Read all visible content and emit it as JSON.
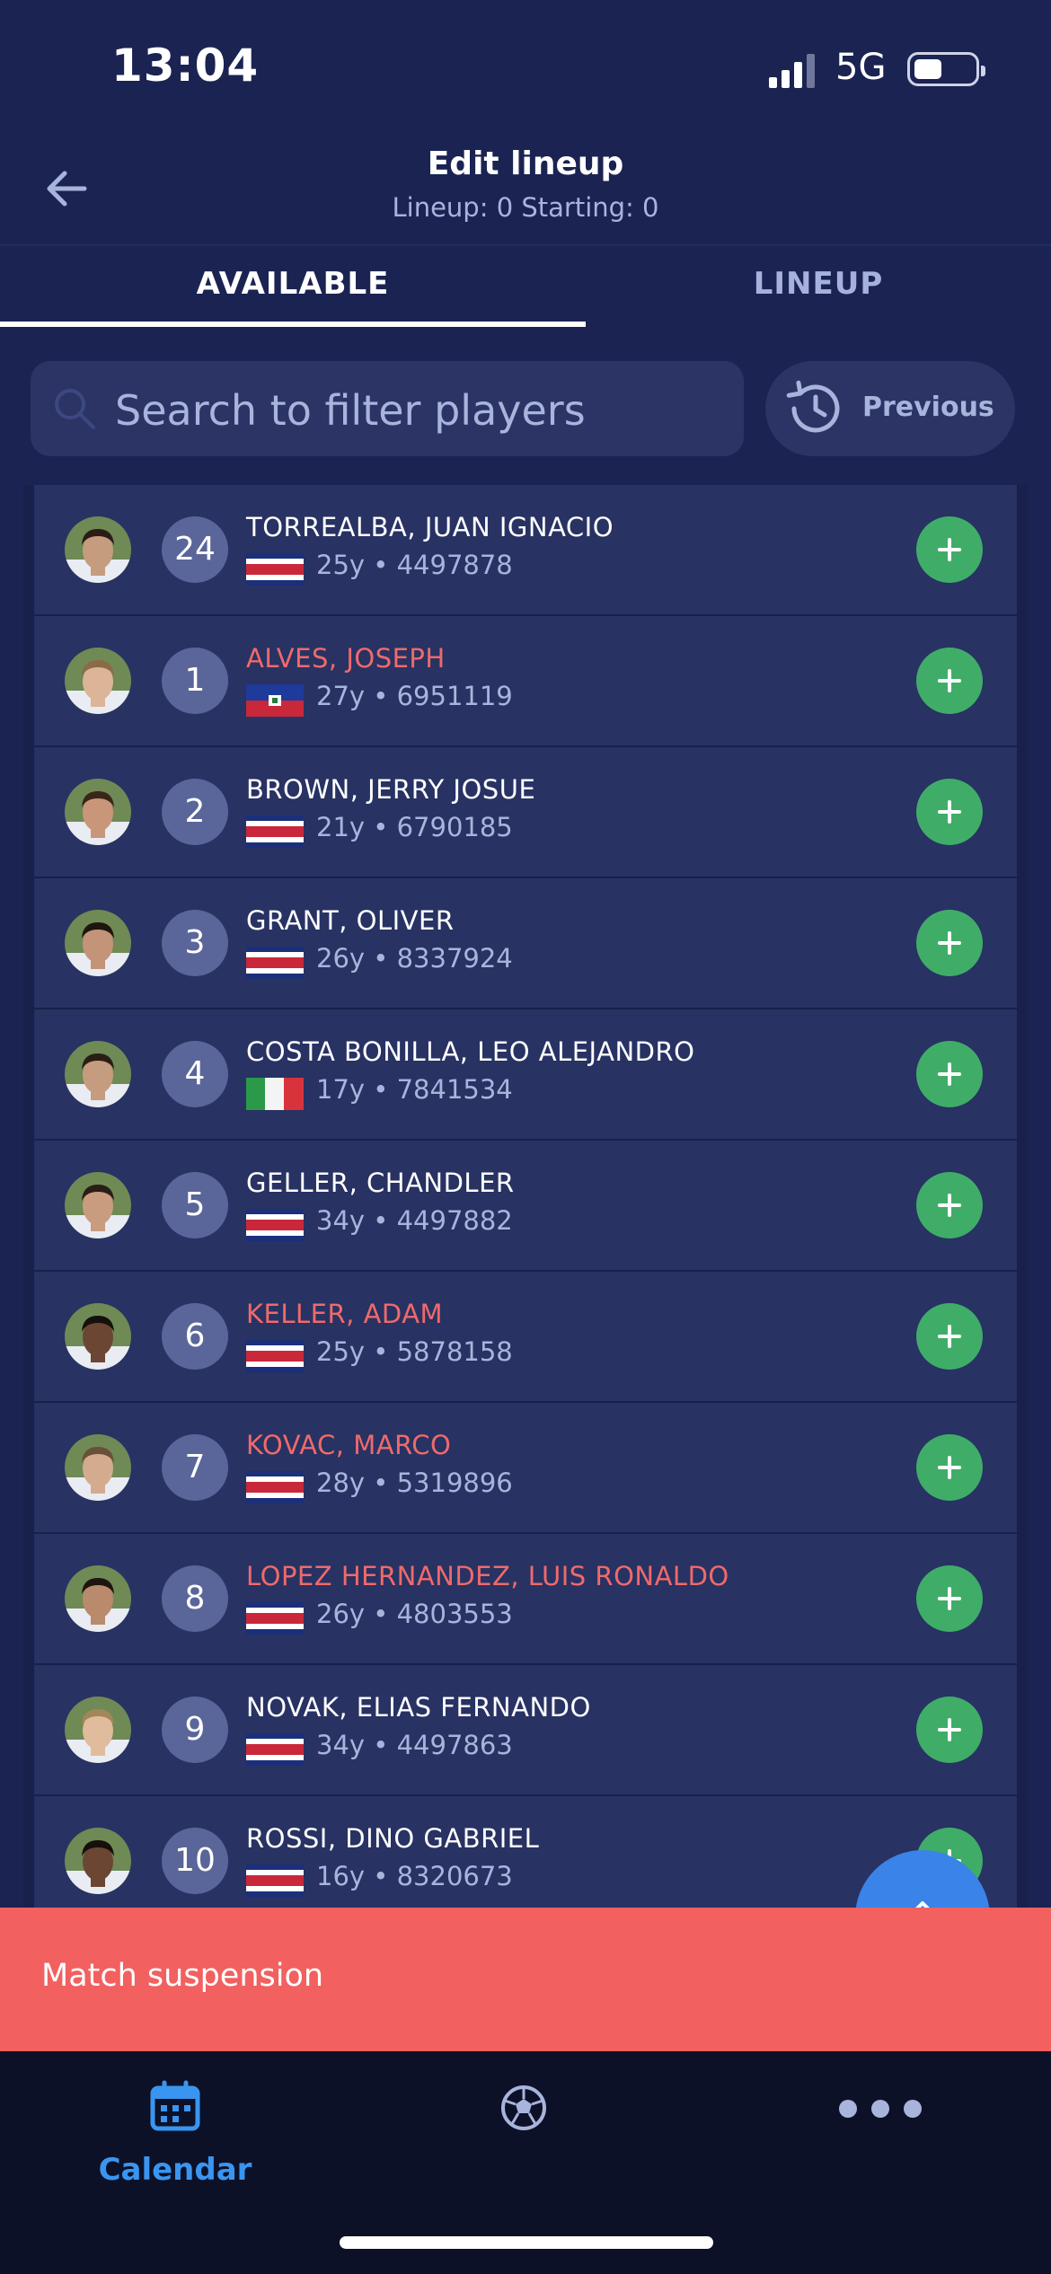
{
  "status_bar": {
    "time": "13:04",
    "network": "5G",
    "battery_level": 0.45
  },
  "header": {
    "title": "Edit lineup",
    "subtitle": "Lineup: 0 Starting: 0",
    "back_icon": "arrow-left-icon"
  },
  "tabs": {
    "available": "AVAILABLE",
    "lineup": "LINEUP",
    "active": "AVAILABLE"
  },
  "search": {
    "placeholder": "Search to filter players",
    "icon": "search-icon"
  },
  "previous_button": {
    "label": "Previous",
    "icon": "history-icon"
  },
  "players": [
    {
      "number": "24",
      "name": "TORREALBA, JUAN IGNACIO",
      "meta": "25y • 4497878",
      "flag": "costa-rica",
      "suspended": false,
      "skin": "#c69c7e",
      "hair": "#2a1d16"
    },
    {
      "number": "1",
      "name": "ALVES, JOSEPH",
      "meta": "27y • 6951119",
      "flag": "haiti",
      "suspended": true,
      "skin": "#dcb497",
      "hair": "#8a6b45"
    },
    {
      "number": "2",
      "name": "BROWN, JERRY JOSUE",
      "meta": "21y • 6790185",
      "flag": "costa-rica",
      "suspended": false,
      "skin": "#c9967a",
      "hair": "#3a2618"
    },
    {
      "number": "3",
      "name": "GRANT, OLIVER",
      "meta": "26y • 8337924",
      "flag": "costa-rica",
      "suspended": false,
      "skin": "#c39478",
      "hair": "#1e1510"
    },
    {
      "number": "4",
      "name": "COSTA BONILLA, LEO ALEJANDRO",
      "meta": "17y • 7841534",
      "flag": "italy",
      "suspended": false,
      "skin": "#c69c7e",
      "hair": "#2a1d16"
    },
    {
      "number": "5",
      "name": "GELLER, CHANDLER",
      "meta": "34y • 4497882",
      "flag": "costa-rica",
      "suspended": false,
      "skin": "#c99c80",
      "hair": "#2a1d16"
    },
    {
      "number": "6",
      "name": "KELLER, ADAM",
      "meta": "25y • 5878158",
      "flag": "costa-rica",
      "suspended": true,
      "skin": "#6b4633",
      "hair": "#15100c"
    },
    {
      "number": "7",
      "name": "KOVAC, MARCO",
      "meta": "28y • 5319896",
      "flag": "costa-rica",
      "suspended": true,
      "skin": "#d4ab8f",
      "hair": "#6a5038"
    },
    {
      "number": "8",
      "name": "LOPEZ HERNANDEZ, LUIS RONALDO",
      "meta": "26y • 4803553",
      "flag": "costa-rica",
      "suspended": true,
      "skin": "#b98a6c",
      "hair": "#1e1510"
    },
    {
      "number": "9",
      "name": "NOVAK, ELIAS FERNANDO",
      "meta": "34y • 4497863",
      "flag": "costa-rica",
      "suspended": false,
      "skin": "#e0bb9c",
      "hair": "#a3865a"
    },
    {
      "number": "10",
      "name": "ROSSI, DINO GABRIEL",
      "meta": "16y • 8320673",
      "flag": "costa-rica",
      "suspended": false,
      "skin": "#6b4633",
      "hair": "#15100c"
    }
  ],
  "snackbar": {
    "text": "Match suspension",
    "color": "#f26060"
  },
  "bottom_nav": {
    "items": [
      {
        "label": "Calendar",
        "icon": "calendar-icon",
        "active": true
      },
      {
        "label": "",
        "icon": "soccer-ball-icon",
        "active": false
      },
      {
        "label": "",
        "icon": "more-dots-icon",
        "active": false
      }
    ]
  },
  "colors": {
    "background": "#1b2352",
    "accent": "#3a95f0",
    "add_button": "#3fad68",
    "suspended_text": "#ef6a6a"
  }
}
